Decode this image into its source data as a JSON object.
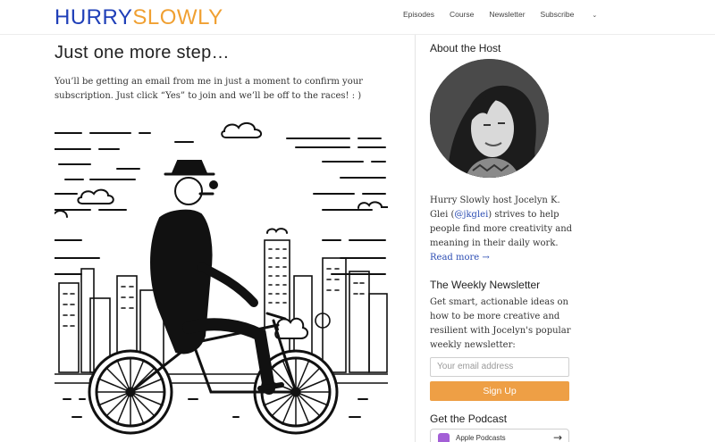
{
  "header": {
    "logo_part1": "HURRY",
    "logo_part2": "SLOWLY",
    "nav": [
      "Episodes",
      "Course",
      "Newsletter",
      "Subscribe"
    ],
    "subscribe_chevron": "chevron-down-icon"
  },
  "main": {
    "title": "Just one more step…",
    "intro": "You’ll be getting an email from me in just a moment to confirm your subscription. Just click “Yes” to join and we’ll be off to the races! : )",
    "illustration": "man-on-bicycle-illustration"
  },
  "sidebar": {
    "about_heading": "About the Host",
    "bio_before": "Hurry Slowly host Jocelyn K. Glei (",
    "bio_handle": "@jkglei",
    "bio_after": ") strives to help people find more creativity and meaning in their daily work.",
    "read_more": "Read more →",
    "newsletter_heading": "The Weekly Newsletter",
    "newsletter_desc": "Get smart, actionable ideas on how to be more creative and resilient with Jocelyn's popular weekly newsletter:",
    "email_placeholder": "Your email address",
    "signup_label": "Sign Up",
    "podcast_heading": "Get the Podcast",
    "podcast_button": "Apple Podcasts"
  },
  "colors": {
    "logo_blue": "#1f3fb8",
    "logo_orange": "#f0a032",
    "button": "#ee9f45",
    "link": "#2c4db3"
  }
}
